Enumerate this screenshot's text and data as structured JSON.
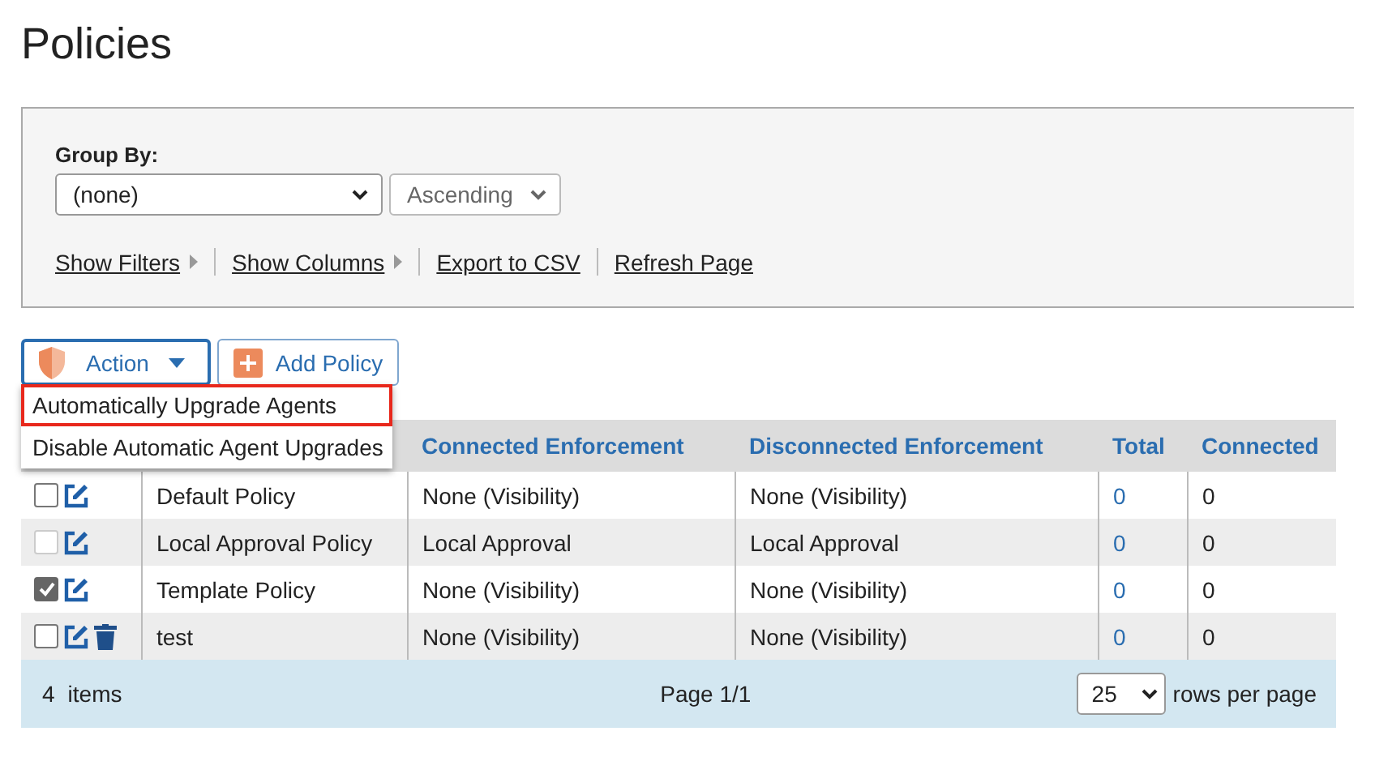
{
  "title": "Policies",
  "filters": {
    "group_by_label": "Group By:",
    "group_by_value": "(none)",
    "order_value": "Ascending",
    "links": [
      "Show Filters",
      "Show Columns",
      "Export to CSV",
      "Refresh Page"
    ]
  },
  "toolbar": {
    "action_button": "Action",
    "add_button": "Add Policy",
    "menu_open": true
  },
  "action_menu": [
    {
      "label": "Automatically Upgrade Agents",
      "highlighted": true
    },
    {
      "label": "Disable Automatic Agent Upgrades",
      "highlighted": false
    }
  ],
  "table": {
    "columns": [
      "Connected Enforcement",
      "Disconnected Enforcement",
      "Total",
      "Connected"
    ],
    "rows": [
      {
        "checked": false,
        "disabled": false,
        "deletable": false,
        "name": "Default Policy",
        "connected_enforcement": "None (Visibility)",
        "disconnected_enforcement": "None (Visibility)",
        "total": "0",
        "connected": "0"
      },
      {
        "checked": false,
        "disabled": true,
        "deletable": false,
        "name": "Local Approval Policy",
        "connected_enforcement": "Local Approval",
        "disconnected_enforcement": "Local Approval",
        "total": "0",
        "connected": "0"
      },
      {
        "checked": true,
        "disabled": false,
        "deletable": false,
        "name": "Template Policy",
        "connected_enforcement": "None (Visibility)",
        "disconnected_enforcement": "None (Visibility)",
        "total": "0",
        "connected": "0"
      },
      {
        "checked": false,
        "disabled": false,
        "deletable": true,
        "name": "test",
        "connected_enforcement": "None (Visibility)",
        "disconnected_enforcement": "None (Visibility)",
        "total": "0",
        "connected": "0"
      }
    ]
  },
  "footer": {
    "count": "4",
    "items_label": "items",
    "page": "Page 1/1",
    "rows_per_page_value": "25",
    "rows_per_page_label": "rows per page"
  }
}
